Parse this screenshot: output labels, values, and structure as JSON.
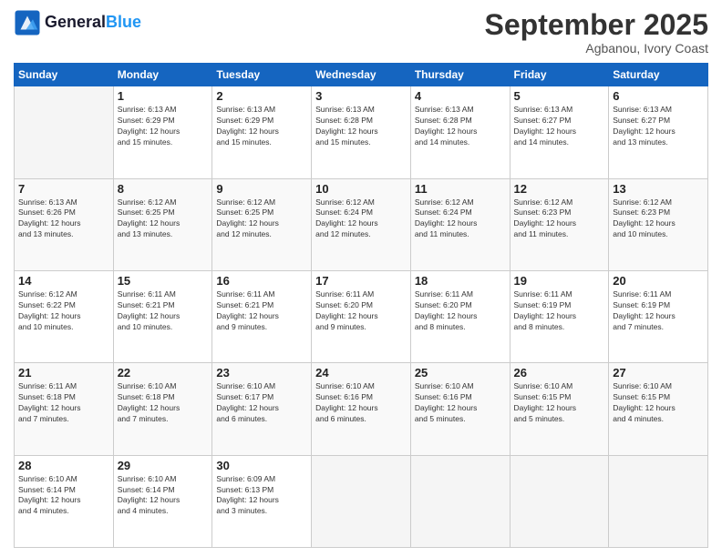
{
  "header": {
    "logo_line1": "General",
    "logo_line2": "Blue",
    "month": "September 2025",
    "location": "Agbanou, Ivory Coast"
  },
  "weekdays": [
    "Sunday",
    "Monday",
    "Tuesday",
    "Wednesday",
    "Thursday",
    "Friday",
    "Saturday"
  ],
  "weeks": [
    [
      {
        "day": "",
        "info": ""
      },
      {
        "day": "1",
        "info": "Sunrise: 6:13 AM\nSunset: 6:29 PM\nDaylight: 12 hours\nand 15 minutes."
      },
      {
        "day": "2",
        "info": "Sunrise: 6:13 AM\nSunset: 6:29 PM\nDaylight: 12 hours\nand 15 minutes."
      },
      {
        "day": "3",
        "info": "Sunrise: 6:13 AM\nSunset: 6:28 PM\nDaylight: 12 hours\nand 15 minutes."
      },
      {
        "day": "4",
        "info": "Sunrise: 6:13 AM\nSunset: 6:28 PM\nDaylight: 12 hours\nand 14 minutes."
      },
      {
        "day": "5",
        "info": "Sunrise: 6:13 AM\nSunset: 6:27 PM\nDaylight: 12 hours\nand 14 minutes."
      },
      {
        "day": "6",
        "info": "Sunrise: 6:13 AM\nSunset: 6:27 PM\nDaylight: 12 hours\nand 13 minutes."
      }
    ],
    [
      {
        "day": "7",
        "info": "Sunrise: 6:13 AM\nSunset: 6:26 PM\nDaylight: 12 hours\nand 13 minutes."
      },
      {
        "day": "8",
        "info": "Sunrise: 6:12 AM\nSunset: 6:25 PM\nDaylight: 12 hours\nand 13 minutes."
      },
      {
        "day": "9",
        "info": "Sunrise: 6:12 AM\nSunset: 6:25 PM\nDaylight: 12 hours\nand 12 minutes."
      },
      {
        "day": "10",
        "info": "Sunrise: 6:12 AM\nSunset: 6:24 PM\nDaylight: 12 hours\nand 12 minutes."
      },
      {
        "day": "11",
        "info": "Sunrise: 6:12 AM\nSunset: 6:24 PM\nDaylight: 12 hours\nand 11 minutes."
      },
      {
        "day": "12",
        "info": "Sunrise: 6:12 AM\nSunset: 6:23 PM\nDaylight: 12 hours\nand 11 minutes."
      },
      {
        "day": "13",
        "info": "Sunrise: 6:12 AM\nSunset: 6:23 PM\nDaylight: 12 hours\nand 10 minutes."
      }
    ],
    [
      {
        "day": "14",
        "info": "Sunrise: 6:12 AM\nSunset: 6:22 PM\nDaylight: 12 hours\nand 10 minutes."
      },
      {
        "day": "15",
        "info": "Sunrise: 6:11 AM\nSunset: 6:21 PM\nDaylight: 12 hours\nand 10 minutes."
      },
      {
        "day": "16",
        "info": "Sunrise: 6:11 AM\nSunset: 6:21 PM\nDaylight: 12 hours\nand 9 minutes."
      },
      {
        "day": "17",
        "info": "Sunrise: 6:11 AM\nSunset: 6:20 PM\nDaylight: 12 hours\nand 9 minutes."
      },
      {
        "day": "18",
        "info": "Sunrise: 6:11 AM\nSunset: 6:20 PM\nDaylight: 12 hours\nand 8 minutes."
      },
      {
        "day": "19",
        "info": "Sunrise: 6:11 AM\nSunset: 6:19 PM\nDaylight: 12 hours\nand 8 minutes."
      },
      {
        "day": "20",
        "info": "Sunrise: 6:11 AM\nSunset: 6:19 PM\nDaylight: 12 hours\nand 7 minutes."
      }
    ],
    [
      {
        "day": "21",
        "info": "Sunrise: 6:11 AM\nSunset: 6:18 PM\nDaylight: 12 hours\nand 7 minutes."
      },
      {
        "day": "22",
        "info": "Sunrise: 6:10 AM\nSunset: 6:18 PM\nDaylight: 12 hours\nand 7 minutes."
      },
      {
        "day": "23",
        "info": "Sunrise: 6:10 AM\nSunset: 6:17 PM\nDaylight: 12 hours\nand 6 minutes."
      },
      {
        "day": "24",
        "info": "Sunrise: 6:10 AM\nSunset: 6:16 PM\nDaylight: 12 hours\nand 6 minutes."
      },
      {
        "day": "25",
        "info": "Sunrise: 6:10 AM\nSunset: 6:16 PM\nDaylight: 12 hours\nand 5 minutes."
      },
      {
        "day": "26",
        "info": "Sunrise: 6:10 AM\nSunset: 6:15 PM\nDaylight: 12 hours\nand 5 minutes."
      },
      {
        "day": "27",
        "info": "Sunrise: 6:10 AM\nSunset: 6:15 PM\nDaylight: 12 hours\nand 4 minutes."
      }
    ],
    [
      {
        "day": "28",
        "info": "Sunrise: 6:10 AM\nSunset: 6:14 PM\nDaylight: 12 hours\nand 4 minutes."
      },
      {
        "day": "29",
        "info": "Sunrise: 6:10 AM\nSunset: 6:14 PM\nDaylight: 12 hours\nand 4 minutes."
      },
      {
        "day": "30",
        "info": "Sunrise: 6:09 AM\nSunset: 6:13 PM\nDaylight: 12 hours\nand 3 minutes."
      },
      {
        "day": "",
        "info": ""
      },
      {
        "day": "",
        "info": ""
      },
      {
        "day": "",
        "info": ""
      },
      {
        "day": "",
        "info": ""
      }
    ]
  ]
}
